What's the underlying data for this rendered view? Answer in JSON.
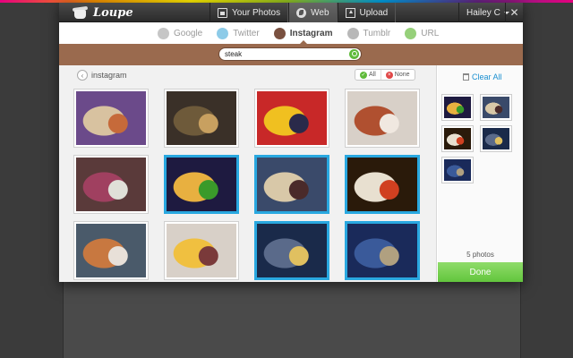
{
  "app": {
    "name": "Loupe"
  },
  "top_nav": {
    "tabs": [
      {
        "label": "Your Photos",
        "icon": "photos-icon",
        "active": false
      },
      {
        "label": "Web",
        "icon": "web-icon",
        "active": true
      },
      {
        "label": "Upload",
        "icon": "upload-icon",
        "active": false
      }
    ],
    "user": "Hailey C",
    "close_glyph": "✕"
  },
  "sources": [
    {
      "label": "Google",
      "icon": "google-icon",
      "color": "#c6c6c6",
      "active": false
    },
    {
      "label": "Twitter",
      "icon": "twitter-icon",
      "color": "#8dcbe8",
      "active": false
    },
    {
      "label": "Instagram",
      "icon": "instagram-icon",
      "color": "#7a5140",
      "active": true
    },
    {
      "label": "Tumblr",
      "icon": "tumblr-icon",
      "color": "#b8b8b8",
      "active": false
    },
    {
      "label": "URL",
      "icon": "url-icon",
      "color": "#96d07a",
      "active": false
    }
  ],
  "search": {
    "value": "steak",
    "placeholder": ""
  },
  "breadcrumb": {
    "back_glyph": "‹",
    "label": "instagram"
  },
  "selection": {
    "all_label": "All",
    "none_label": "None"
  },
  "photos": [
    {
      "selected": false,
      "colors": [
        "#6b4a8a",
        "#d8c2a0",
        "#c66a3a"
      ]
    },
    {
      "selected": false,
      "colors": [
        "#3a3028",
        "#6e5a3a",
        "#c8a060"
      ]
    },
    {
      "selected": false,
      "colors": [
        "#c82828",
        "#f0c020",
        "#2a2a4a"
      ]
    },
    {
      "selected": false,
      "colors": [
        "#d8d0c8",
        "#b05030",
        "#f0e8e0"
      ]
    },
    {
      "selected": false,
      "colors": [
        "#5a3a3a",
        "#a04060",
        "#e0e0d8"
      ]
    },
    {
      "selected": true,
      "colors": [
        "#1e1a40",
        "#e8b040",
        "#3a9a2a"
      ]
    },
    {
      "selected": true,
      "colors": [
        "#3a4a6a",
        "#d8c8a8",
        "#4a2a2a"
      ]
    },
    {
      "selected": true,
      "colors": [
        "#2a1a0a",
        "#e8e0d0",
        "#d04020"
      ]
    },
    {
      "selected": false,
      "colors": [
        "#4a5a6a",
        "#c87840",
        "#e8e0d8"
      ]
    },
    {
      "selected": false,
      "colors": [
        "#d8d0c8",
        "#f0c040",
        "#7a3a3a"
      ]
    },
    {
      "selected": true,
      "colors": [
        "#1a2a4a",
        "#5a6a8a",
        "#e0c060"
      ]
    },
    {
      "selected": true,
      "colors": [
        "#1a2a5a",
        "#3a5a9a",
        "#b0a080"
      ]
    }
  ],
  "tray": {
    "clear_label": "Clear All",
    "photo_count": "5 photos",
    "done_label": "Done",
    "thumbs": [
      {
        "colors": [
          "#1e1a40",
          "#e8b040",
          "#3a9a2a"
        ]
      },
      {
        "colors": [
          "#3a4a6a",
          "#d8c8a8",
          "#4a2a2a"
        ]
      },
      {
        "colors": [
          "#2a1a0a",
          "#e8e0d0",
          "#d04020"
        ]
      },
      {
        "colors": [
          "#1a2a4a",
          "#5a6a8a",
          "#e0c060"
        ]
      },
      {
        "colors": [
          "#1a2a5a",
          "#3a5a9a",
          "#b0a080"
        ]
      }
    ]
  },
  "accent": {
    "selection": "#29a8e0",
    "done": "#62c53d",
    "search_strip": "#9a6a4e",
    "link": "#1a8fd0"
  }
}
